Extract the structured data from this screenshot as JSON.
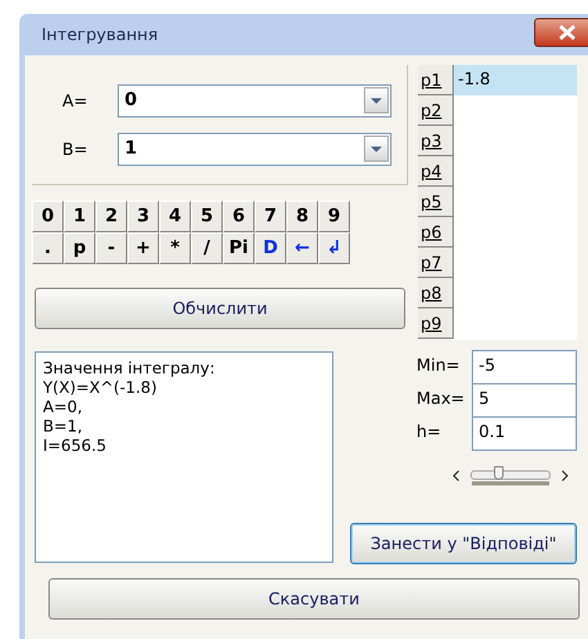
{
  "window": {
    "title": "Інтегрування"
  },
  "limits": [
    {
      "label": "A=",
      "value": "0"
    },
    {
      "label": "B=",
      "value": "1"
    }
  ],
  "keypad": [
    [
      {
        "label": "0",
        "kind": "char"
      },
      {
        "label": "1",
        "kind": "char"
      },
      {
        "label": "2",
        "kind": "char"
      },
      {
        "label": "3",
        "kind": "char"
      },
      {
        "label": "4",
        "kind": "char"
      },
      {
        "label": "5",
        "kind": "char"
      },
      {
        "label": "6",
        "kind": "char"
      },
      {
        "label": "7",
        "kind": "char"
      },
      {
        "label": "8",
        "kind": "char"
      },
      {
        "label": "9",
        "kind": "char"
      }
    ],
    [
      {
        "label": ".",
        "kind": "char"
      },
      {
        "label": "p",
        "kind": "char"
      },
      {
        "label": "-",
        "kind": "char"
      },
      {
        "label": "+",
        "kind": "char"
      },
      {
        "label": "*",
        "kind": "char"
      },
      {
        "label": "/",
        "kind": "char"
      },
      {
        "label": "Pi",
        "kind": "char"
      },
      {
        "label": "D",
        "kind": "command"
      },
      {
        "label": "←",
        "kind": "command"
      },
      {
        "label": "↲",
        "kind": "command"
      }
    ]
  ],
  "compute_button": "Обчислити",
  "params": [
    "p1",
    "p2",
    "p3",
    "p4",
    "p5",
    "p6",
    "p7",
    "p8",
    "p9"
  ],
  "param_values": [
    {
      "value": "-1.8",
      "selected": true
    }
  ],
  "result_lines": [
    "Значення інтегралу:",
    "Y(X)=X^(-1.8)",
    "A=0,",
    "B=1,",
    "I=656.5"
  ],
  "range": [
    {
      "label": "Min=",
      "value": "-5"
    },
    {
      "label": "Max=",
      "value": "5"
    },
    {
      "label": "h=",
      "value": "0.1"
    }
  ],
  "slider": {
    "level": 0.35
  },
  "save_button": "Занести у \"Відповіді\"",
  "cancel_button": "Скасувати"
}
